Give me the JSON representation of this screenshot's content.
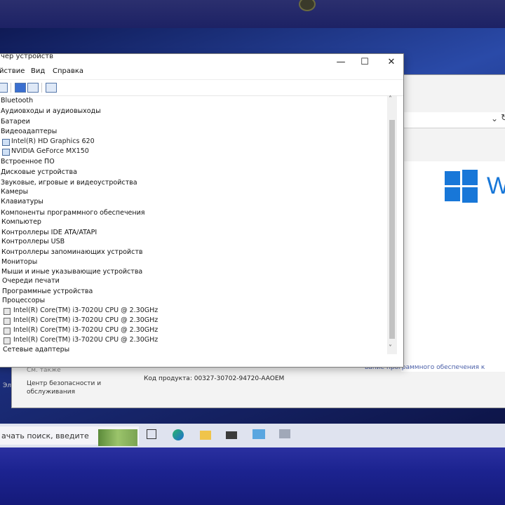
{
  "device_manager": {
    "title": "чер устройств",
    "controls": {
      "minimize": "—",
      "maximize": "☐",
      "close": "✕"
    },
    "menu": [
      "йствие",
      "Вид",
      "Справка"
    ],
    "tree": [
      {
        "label": "Bluetooth",
        "level": 0
      },
      {
        "label": "Аудиовходы и аудиовыходы",
        "level": 0
      },
      {
        "label": "Батареи",
        "level": 0
      },
      {
        "label": "Видеоадаптеры",
        "level": 0
      },
      {
        "label": "Intel(R) HD Graphics 620",
        "level": 1,
        "icon": "display-adapter-icon"
      },
      {
        "label": "NVIDIA GeForce MX150",
        "level": 1,
        "icon": "display-adapter-icon"
      },
      {
        "label": "Встроенное ПО",
        "level": 0
      },
      {
        "label": "Дисковые устройства",
        "level": 0
      },
      {
        "label": "Звуковые, игровые и видеоустройства",
        "level": 0
      },
      {
        "label": "Камеры",
        "level": 0
      },
      {
        "label": "Клавиатуры",
        "level": 0
      },
      {
        "label": "Компоненты программного обеспечения",
        "level": 0
      },
      {
        "label": "Компьютер",
        "level": 0
      },
      {
        "label": "Контроллеры IDE ATA/ATAPI",
        "level": 0
      },
      {
        "label": "Контроллеры USB",
        "level": 0
      },
      {
        "label": "Контроллеры запоминающих устройств",
        "level": 0
      },
      {
        "label": "Мониторы",
        "level": 0
      },
      {
        "label": "Мыши и иные указывающие устройства",
        "level": 0
      },
      {
        "label": "Очереди печати",
        "level": 0
      },
      {
        "label": "Программные устройства",
        "level": 0
      },
      {
        "label": "Процессоры",
        "level": 0
      },
      {
        "label": "Intel(R) Core(TM) i3-7020U CPU @ 2.30GHz",
        "level": 1,
        "icon": "processor-icon"
      },
      {
        "label": "Intel(R) Core(TM) i3-7020U CPU @ 2.30GHz",
        "level": 1,
        "icon": "processor-icon"
      },
      {
        "label": "Intel(R) Core(TM) i3-7020U CPU @ 2.30GHz",
        "level": 1,
        "icon": "processor-icon"
      },
      {
        "label": "Intel(R) Core(TM) i3-7020U CPU @ 2.30GHz",
        "level": 1,
        "icon": "processor-icon"
      },
      {
        "label": "Сетевые адаптеры",
        "level": 0
      }
    ]
  },
  "system_window": {
    "see_also": "См. также",
    "security_center": "Центр безопасности и обслуживания",
    "product_id_label": "Код продукта: 00327-30702-94720-AAOEM",
    "change_key_link": "вание программного обеспечения к",
    "windows_word": "W",
    "left_label": "Эл"
  },
  "taskbar": {
    "search_placeholder": "ачать поиск, введите"
  },
  "colors": {
    "windows_blue": "#1877d8",
    "wallpaper": "#1b2d7a"
  }
}
